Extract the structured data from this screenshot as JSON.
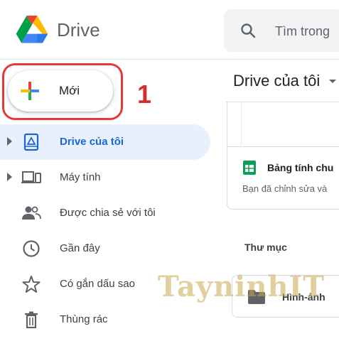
{
  "header": {
    "app_title": "Drive",
    "logo_icon": "google-drive-logo",
    "search": {
      "icon": "search-icon",
      "placeholder": "Tìm trong"
    }
  },
  "new_button": {
    "label": "Mới",
    "icon": "plus-icon"
  },
  "annotation": {
    "step_number": "1",
    "color": "#d32f2f"
  },
  "sidebar": {
    "items": [
      {
        "label": "Drive của tôi",
        "icon": "my-drive-icon",
        "active": true,
        "expandable": true
      },
      {
        "label": "Máy tính",
        "icon": "computers-icon",
        "active": false,
        "expandable": true
      },
      {
        "label": "Được chia sẻ với tôi",
        "icon": "shared-people-icon",
        "active": false,
        "expandable": false
      },
      {
        "label": "Gần đây",
        "icon": "clock-icon",
        "active": false,
        "expandable": false
      },
      {
        "label": "Có gắn dấu sao",
        "icon": "star-icon",
        "active": false,
        "expandable": false
      },
      {
        "label": "Thùng rác",
        "icon": "trash-icon",
        "active": false,
        "expandable": false
      }
    ]
  },
  "main": {
    "title": "Drive của tôi",
    "suggested_file": {
      "name": "Bảng tính chu",
      "meta": "Bạn đã chỉnh sửa và",
      "icon": "sheets-icon"
    },
    "folders_section_label": "Thư mục",
    "folders": [
      {
        "name": "Hình-ảnh",
        "icon": "folder-icon"
      }
    ]
  },
  "watermark": {
    "text": "TayninhIT"
  },
  "colors": {
    "accent": "#1967d2",
    "active_bg": "#e8f0fe",
    "highlight_border": "#e53935"
  }
}
